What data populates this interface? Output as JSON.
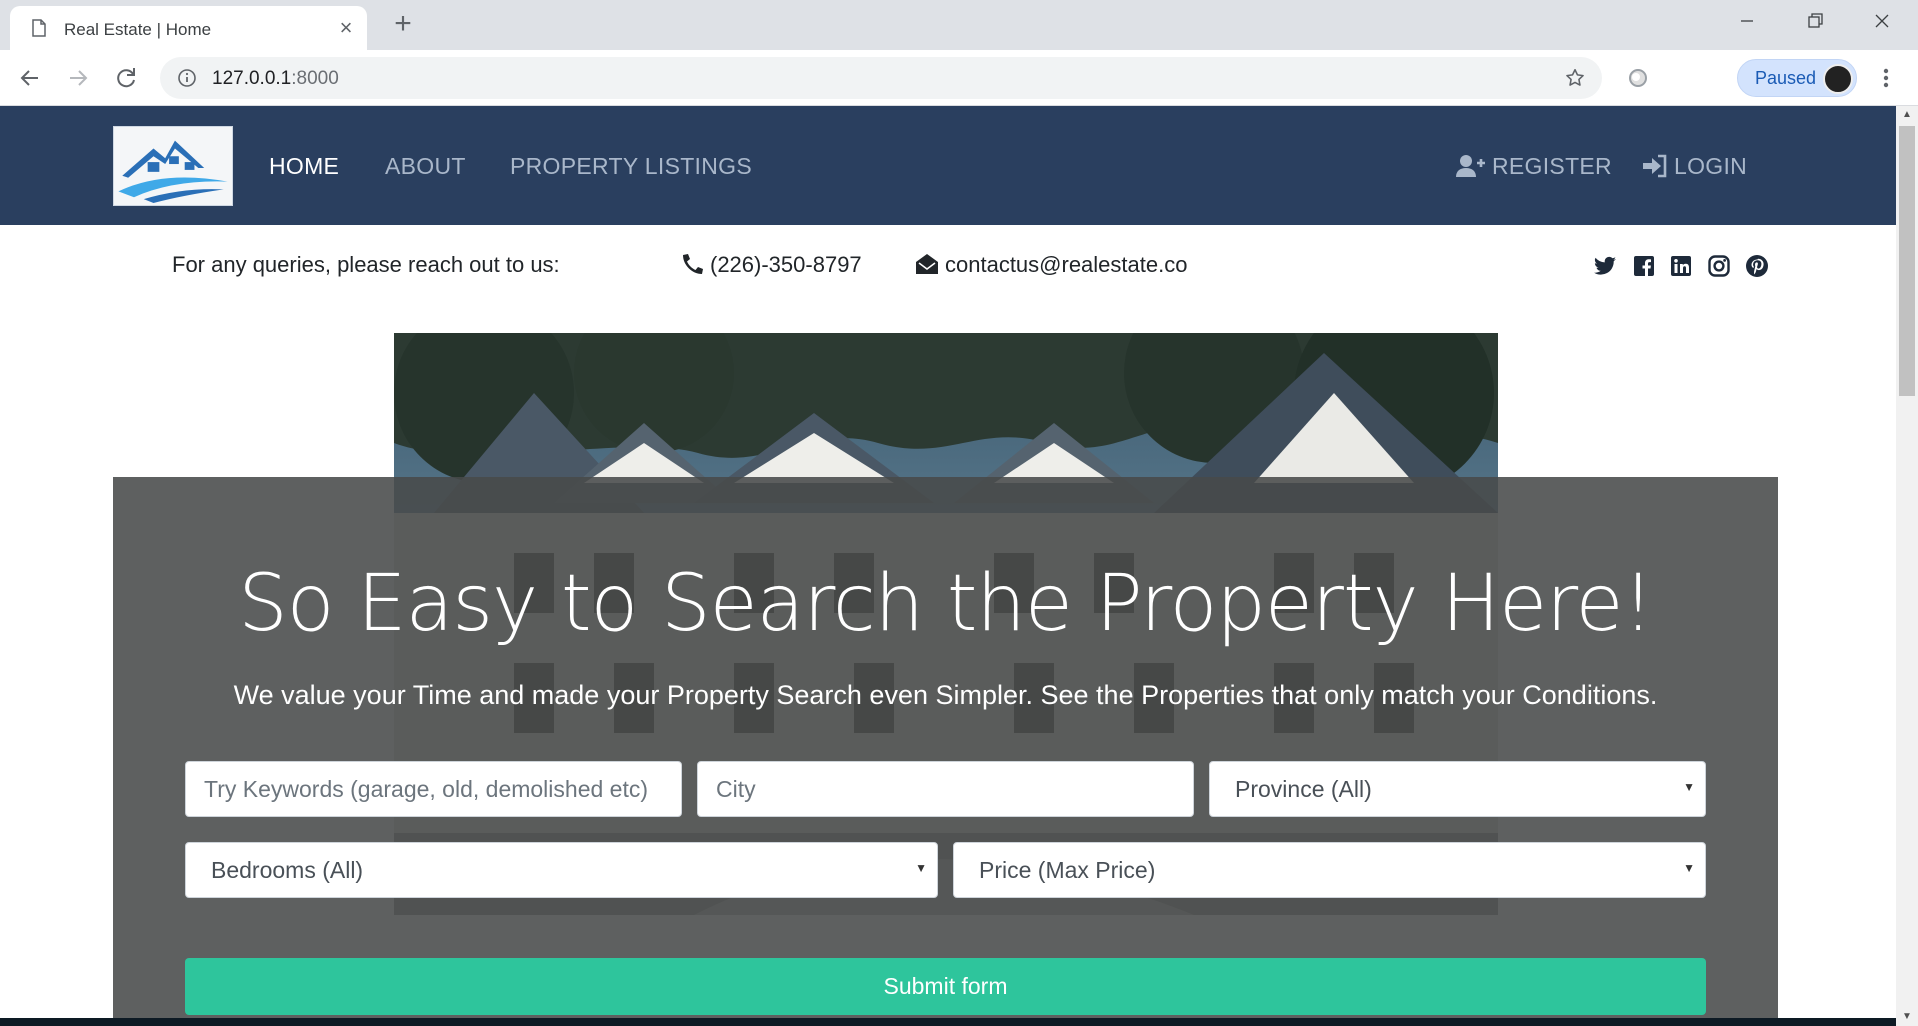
{
  "browser": {
    "tab_title": "Real Estate | Home",
    "url_host": "127.0.0.1",
    "url_port": ":8000",
    "profile_label": "Paused",
    "icons": [
      "page-icon",
      "close-icon",
      "plus-icon",
      "back-icon",
      "forward-icon",
      "reload-icon",
      "info-icon",
      "star-icon",
      "extension-icon",
      "kebab-menu-icon"
    ]
  },
  "nav": {
    "home": "HOME",
    "about": "ABOUT",
    "listings": "PROPERTY LISTINGS",
    "register": "REGISTER",
    "login": "LOGIN",
    "active": "HOME",
    "bg_color": "#2a3f5f",
    "link_color": "#a9b7ca"
  },
  "contact": {
    "lead": "For any queries, please reach out to us:",
    "phone": "(226)-350-8797",
    "email": "contactus@realestate.co",
    "social_icons": [
      "twitter-icon",
      "facebook-icon",
      "linkedin-icon",
      "instagram-icon",
      "pinterest-icon"
    ]
  },
  "hero": {
    "title": "So Easy to Search the Property Here!",
    "subtitle": "We value your Time and made your Property Search even Simpler. See the Properties that only match your Conditions."
  },
  "search": {
    "keywords_placeholder": "Try Keywords (garage, old, demolished etc)",
    "city_placeholder": "City",
    "province": "Province (All)",
    "bedrooms": "Bedrooms (All)",
    "price": "Price (Max Price)",
    "submit": "Submit form",
    "submit_color": "#2ec59c"
  }
}
